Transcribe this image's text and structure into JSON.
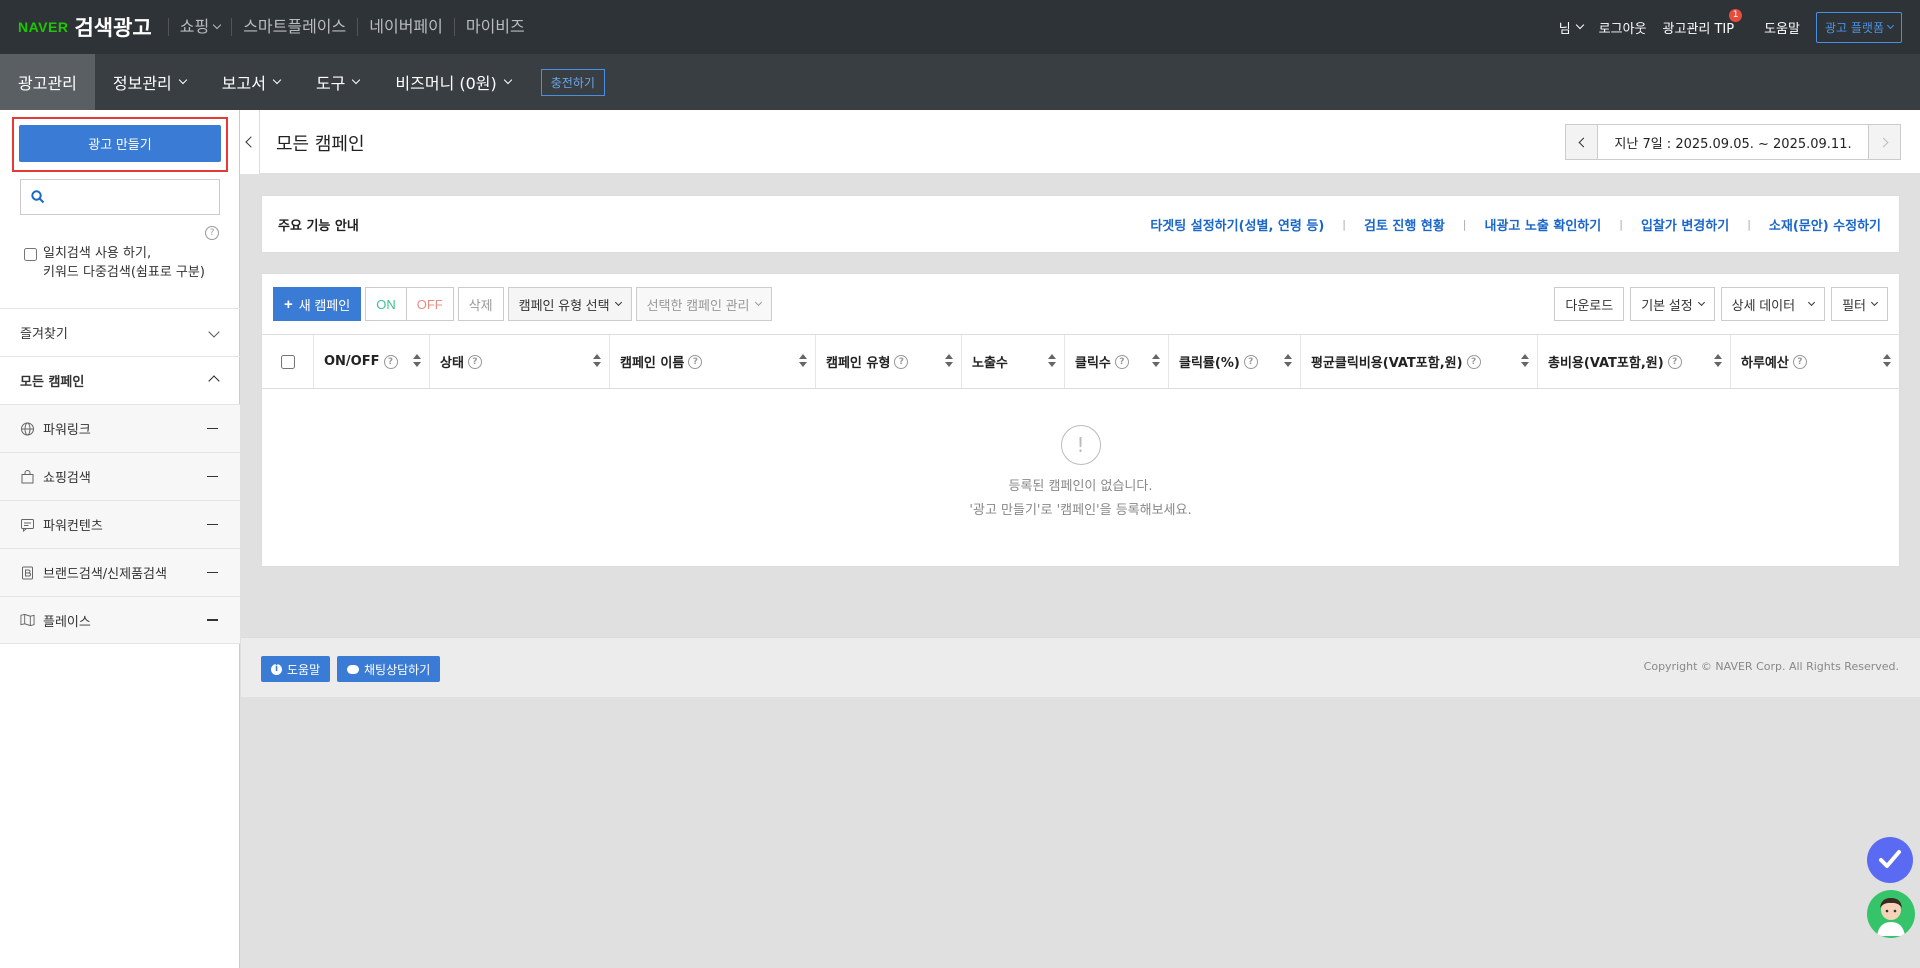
{
  "header": {
    "brand": "NAVER",
    "product": "검색광고",
    "nav": [
      "쇼핑",
      "스마트플레이스",
      "네이버페이",
      "마이비즈"
    ],
    "user": "님",
    "logout": "로그아웃",
    "tip": "광고관리 TIP",
    "tip_badge": "1",
    "help": "도움말",
    "platform": "광고 플랫폼"
  },
  "menubar": {
    "items": [
      "광고관리",
      "정보관리",
      "보고서",
      "도구",
      "비즈머니 (0원)"
    ],
    "charge": "충전하기"
  },
  "sidebar": {
    "create": "광고 만들기",
    "search_placeholder": "",
    "exact_line1": "일치검색 사용 하기,",
    "exact_line2": "키워드 다중검색(쉼표로 구분)",
    "favorites": "즐겨찾기",
    "all_campaigns": "모든 캠페인",
    "categories": [
      "파워링크",
      "쇼핑검색",
      "파워컨텐츠",
      "브랜드검색/신제품검색",
      "플레이스"
    ]
  },
  "main": {
    "title": "모든 캠페인",
    "date_range": "지난 7일 : 2025.09.05. ~ 2025.09.11."
  },
  "guide": {
    "label": "주요 기능 안내",
    "links": [
      "타겟팅 설정하기(성별, 연령 등)",
      "검토 진행 현황",
      "내광고 노출 확인하기",
      "입찰가 변경하기",
      "소재(문안) 수정하기"
    ]
  },
  "toolbar": {
    "new_campaign": "새 캠페인",
    "on": "ON",
    "off": "OFF",
    "delete": "삭제",
    "type_select": "캠페인 유형 선택",
    "manage_selected": "선택한 캠페인 관리",
    "download": "다운로드",
    "basic_settings": "기본 설정",
    "detail_data": "상세 데이터",
    "filter": "필터"
  },
  "table": {
    "columns": [
      "ON/OFF",
      "상태",
      "캠페인 이름",
      "캠페인 유형",
      "노출수",
      "클릭수",
      "클릭률(%)",
      "평균클릭비용(VAT포함,원)",
      "총비용(VAT포함,원)",
      "하루예산"
    ],
    "empty_line1": "등록된 캠페인이 없습니다.",
    "empty_line2": "'광고 만들기'로 '캠페인'을 등록해보세요."
  },
  "footer": {
    "help": "도움말",
    "chat": "채팅상담하기",
    "copyright": "Copyright © NAVER Corp. All Rights Reserved."
  }
}
